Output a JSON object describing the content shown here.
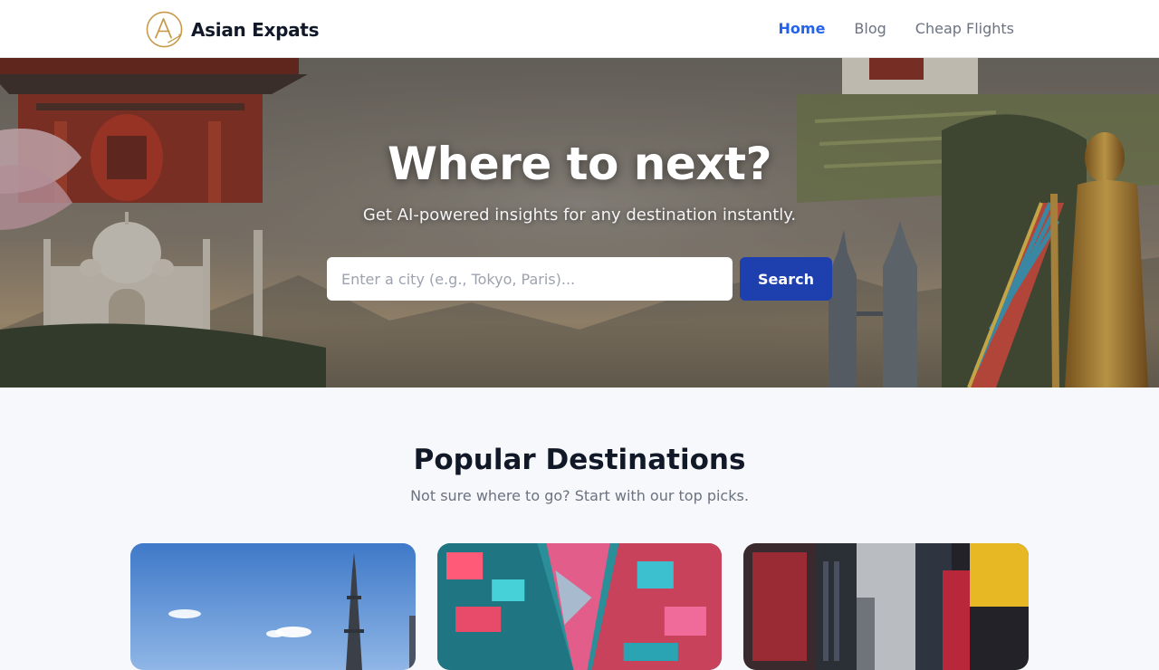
{
  "header": {
    "brand_name": "Asian Expats",
    "nav": [
      {
        "label": "Home",
        "active": true
      },
      {
        "label": "Blog",
        "active": false
      },
      {
        "label": "Cheap Flights",
        "active": false
      }
    ]
  },
  "hero": {
    "title": "Where to next?",
    "subtitle": "Get AI-powered insights for any destination instantly.",
    "search": {
      "placeholder": "Enter a city (e.g., Tokyo, Paris)...",
      "value": "",
      "button_label": "Search"
    }
  },
  "popular": {
    "title": "Popular Destinations",
    "subtitle": "Not sure where to go? Start with our top picks."
  },
  "colors": {
    "accent": "#2563eb",
    "button": "#1e40af",
    "logo_gold": "#c79a4a",
    "page_bg": "#f6f8fb"
  },
  "icons": {
    "logo": "letter-a-circle-logo"
  }
}
